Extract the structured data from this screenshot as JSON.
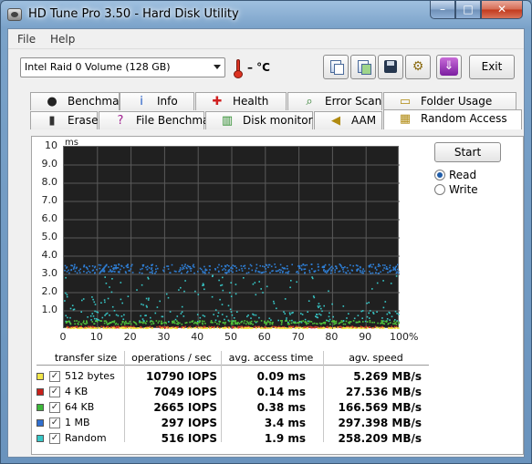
{
  "window": {
    "title": "HD Tune Pro 3.50 - Hard Disk Utility",
    "minimize_glyph": "–",
    "maximize_glyph": "□",
    "close_glyph": "✕"
  },
  "menu": {
    "file": "File",
    "help": "Help"
  },
  "toolbar": {
    "drive": "Intel   Raid 0 Volume (128 GB)",
    "temperature": "– °C",
    "exit_label": "Exit",
    "download_glyph": "⇓",
    "options_glyph": "⚙"
  },
  "tabs_top": [
    {
      "label": "Benchmark",
      "icon": "benchmark-icon",
      "glyph": "●"
    },
    {
      "label": "Info",
      "icon": "info-icon",
      "glyph": "i"
    },
    {
      "label": "Health",
      "icon": "health-icon",
      "glyph": "✚"
    },
    {
      "label": "Error Scan",
      "icon": "magnifier-icon",
      "glyph": "⌕"
    },
    {
      "label": "Folder Usage",
      "icon": "folder-icon",
      "glyph": "▭"
    }
  ],
  "tabs_bottom": [
    {
      "label": "Erase",
      "icon": "trash-icon",
      "glyph": "▮"
    },
    {
      "label": "File Benchmark",
      "icon": "file-benchmark-icon",
      "glyph": "?"
    },
    {
      "label": "Disk monitor",
      "icon": "disk-monitor-icon",
      "glyph": "▥"
    },
    {
      "label": "AAM",
      "icon": "speaker-icon",
      "glyph": "◀"
    },
    {
      "label": "Random Access",
      "icon": "random-access-icon",
      "glyph": "▦",
      "active": true
    }
  ],
  "controls": {
    "start_label": "Start",
    "read_label": "Read",
    "write_label": "Write",
    "mode": "Read"
  },
  "chart_data": {
    "type": "scatter",
    "ylabel": "ms",
    "xlabel": "",
    "ylim": [
      0,
      10
    ],
    "xlim": [
      0,
      100
    ],
    "y_ticks": [
      "1.0",
      "2.0",
      "3.0",
      "4.0",
      "5.0",
      "6.0",
      "7.0",
      "8.0",
      "9.0",
      "10"
    ],
    "x_ticks": [
      "0",
      "10",
      "20",
      "30",
      "40",
      "50",
      "60",
      "70",
      "80",
      "90",
      "100%"
    ],
    "grid": true,
    "background": "#202020",
    "gridcolor": "#5a5a5a",
    "series": [
      {
        "name": "512 bytes",
        "color": "#f2e64a",
        "band": [
          0.05,
          0.12
        ]
      },
      {
        "name": "4 KB",
        "color": "#d23a2a",
        "band": [
          0.1,
          0.18
        ]
      },
      {
        "name": "64 KB",
        "color": "#4fbf3a",
        "band": [
          0.3,
          0.5
        ]
      },
      {
        "name": "1 MB",
        "color": "#2f7fd6",
        "band": [
          3.1,
          3.6
        ]
      },
      {
        "name": "Random",
        "color": "#37c8c8",
        "band": [
          0.4,
          3.0
        ]
      }
    ]
  },
  "results": {
    "headers": {
      "transfer_size": "transfer size",
      "operations": "operations / sec",
      "access_time": "avg. access time",
      "speed": "agv. speed"
    },
    "rows": [
      {
        "size": "512 bytes",
        "color": "#f2e64a",
        "checked": "✓",
        "ops": "10790 IOPS",
        "access": "0.09 ms",
        "speed": "5.269 MB/s"
      },
      {
        "size": "4 KB",
        "color": "#c8201a",
        "checked": "✓",
        "ops": "7049 IOPS",
        "access": "0.14 ms",
        "speed": "27.536 MB/s"
      },
      {
        "size": "64 KB",
        "color": "#3cb83a",
        "checked": "✓",
        "ops": "2665 IOPS",
        "access": "0.38 ms",
        "speed": "166.569 MB/s"
      },
      {
        "size": "1 MB",
        "color": "#2f6fd0",
        "checked": "✓",
        "ops": "297 IOPS",
        "access": "3.4 ms",
        "speed": "297.398 MB/s"
      },
      {
        "size": "Random",
        "color": "#37c8c8",
        "checked": "✓",
        "ops": "516 IOPS",
        "access": "1.9 ms",
        "speed": "258.209 MB/s"
      }
    ]
  }
}
